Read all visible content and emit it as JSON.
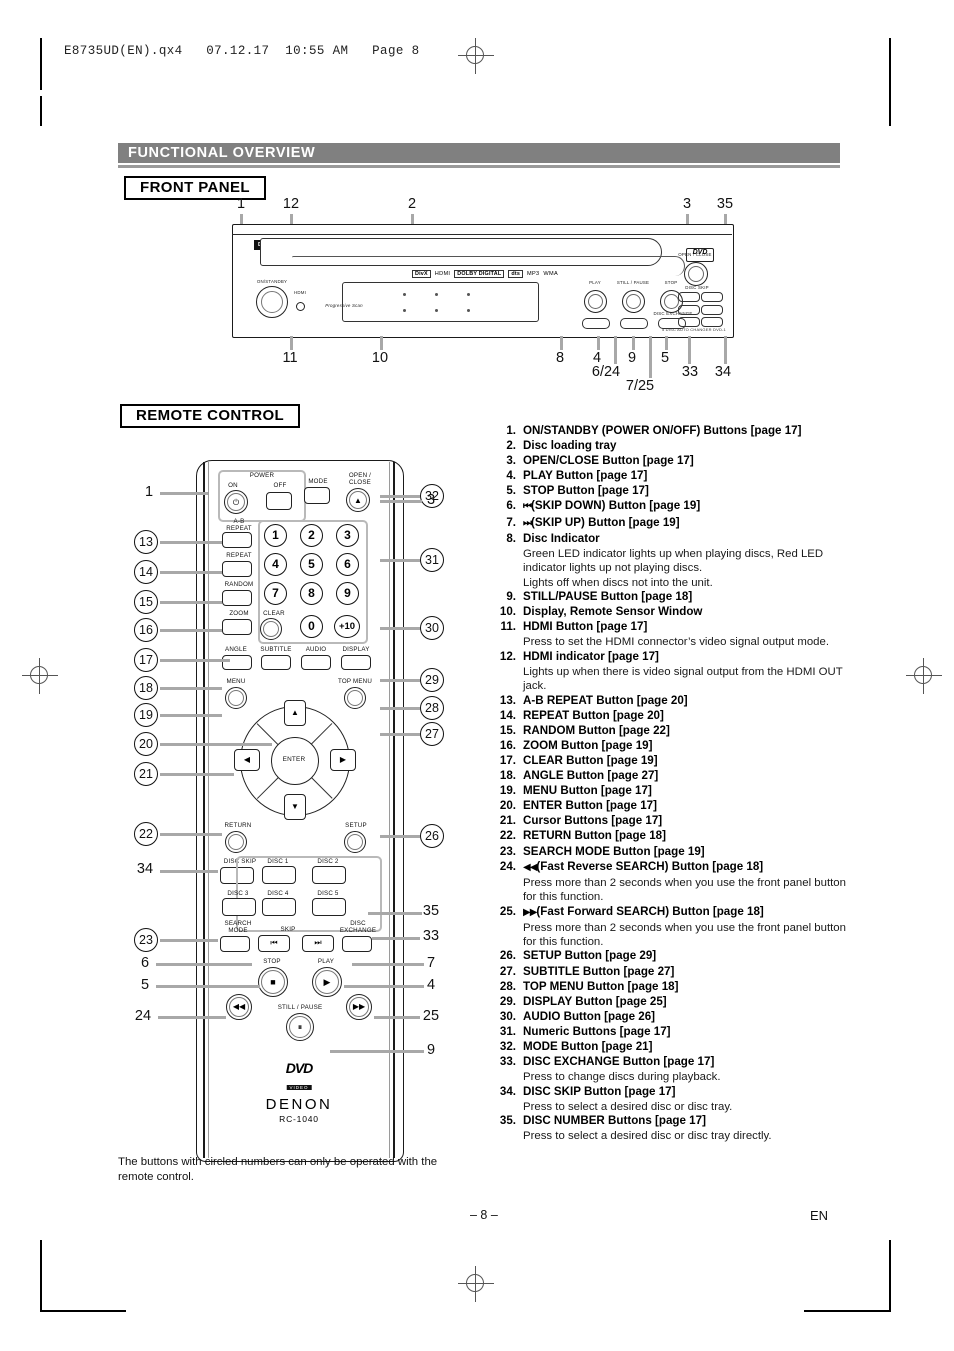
{
  "file_header": "E8735UD(EN).qx4   07.12.17  10:55 AM   Page 8",
  "section": {
    "banner_title": "FUNCTIONAL OVERVIEW"
  },
  "front_panel": {
    "heading": "FRONT PANEL",
    "brand": "DENON",
    "dvd_logo": "DVD",
    "dvd_logo_sub": "VIDEO",
    "model_text": "5 DISC AUTO CHANGER  DVD-1",
    "badges": [
      "DivX",
      "HDMI",
      "DOLBY DIGITAL",
      "dts",
      "MP3",
      "WMA"
    ],
    "progressive_label": "Progressive Scan",
    "power_label": "ON/STANDBY",
    "open_close_label": "OPEN / CLOSE",
    "disc_skip_label": "DISC SKIP",
    "disc_exchange_label": "DISC EXCHANGE",
    "button_labels": [
      "PLAY",
      "STILL / PAUSE",
      "STOP"
    ],
    "callouts_top": [
      "1",
      "12",
      "2",
      "3",
      "35"
    ],
    "callouts_bottom": [
      "11",
      "10",
      "8",
      "4",
      "9",
      "5",
      "6/24",
      "7/25",
      "33",
      "34"
    ]
  },
  "remote": {
    "heading": "REMOTE CONTROL",
    "labels": {
      "power": "POWER",
      "power_on": "ON",
      "power_off": "OFF",
      "mode": "MODE",
      "open_close": "OPEN /\nCLOSE",
      "ab_repeat": "A-B\nREPEAT",
      "repeat": "REPEAT",
      "random": "RANDOM",
      "zoom": "ZOOM",
      "clear": "CLEAR",
      "angle": "ANGLE",
      "subtitle": "SUBTITLE",
      "audio": "AUDIO",
      "display": "DISPLAY",
      "menu": "MENU",
      "top_menu": "TOP MENU",
      "enter": "ENTER",
      "return": "RETURN",
      "setup": "SETUP",
      "disc_skip": "DISC SKIP",
      "search_mode": "SEARCH\nMODE",
      "disc_exchange": "DISC\nEXCHANGE",
      "skip": "SKIP",
      "stop": "STOP",
      "play": "PLAY",
      "still_pause": "STILL / PAUSE"
    },
    "numeric_keys": [
      "1",
      "2",
      "3",
      "4",
      "5",
      "6",
      "7",
      "8",
      "9",
      "0",
      "+10"
    ],
    "disc_keys": [
      "DISC 1",
      "DISC 2",
      "DISC 3",
      "DISC 4",
      "DISC 5"
    ],
    "dvd_logo": "DVD",
    "dvd_logo_sub": "VIDEO",
    "brand": "DENON",
    "model": "RC-1040",
    "callouts_left": [
      "1",
      "13",
      "14",
      "15",
      "16",
      "17",
      "18",
      "19",
      "20",
      "21",
      "22",
      "34",
      "23",
      "6",
      "5",
      "24"
    ],
    "callouts_right": [
      "32",
      "3",
      "31",
      "30",
      "29",
      "28",
      "27",
      "26",
      "35",
      "33",
      "7",
      "4",
      "25",
      "9"
    ]
  },
  "items": [
    {
      "n": "1.",
      "title": "ON/STANDBY (POWER ON/OFF) Buttons [page 17]"
    },
    {
      "n": "2.",
      "title": "Disc loading tray"
    },
    {
      "n": "3.",
      "title": "OPEN/CLOSE Button [page 17]"
    },
    {
      "n": "4.",
      "title": "PLAY Button [page 17]"
    },
    {
      "n": "5.",
      "title": "STOP Button [page 17]"
    },
    {
      "n": "6.",
      "title": "(SKIP DOWN) Button [page 19]",
      "sym": "⏮"
    },
    {
      "n": "7.",
      "title": "(SKIP UP) Button [page 19]",
      "sym": "⏭"
    },
    {
      "n": "8.",
      "title": "Disc Indicator",
      "desc": "Green LED indicator lights up when playing discs, Red LED indicator lights up not playing discs.\nLights off when discs not into the unit."
    },
    {
      "n": "9.",
      "title": "STILL/PAUSE Button [page 18]"
    },
    {
      "n": "10.",
      "title": "Display, Remote Sensor Window"
    },
    {
      "n": "11.",
      "title": "HDMI Button [page 17]",
      "desc": "Press to set the HDMI connector’s video signal output mode."
    },
    {
      "n": "12.",
      "title": "HDMI indicator [page 17]",
      "desc": "Lights up when there is video signal output from the HDMI OUT jack."
    },
    {
      "n": "13.",
      "title": "A-B REPEAT Button [page 20]"
    },
    {
      "n": "14.",
      "title": "REPEAT Button [page 20]"
    },
    {
      "n": "15.",
      "title": "RANDOM Button [page 22]"
    },
    {
      "n": "16.",
      "title": "ZOOM Button [page 19]"
    },
    {
      "n": "17.",
      "title": "CLEAR Button [page 19]"
    },
    {
      "n": "18.",
      "title": "ANGLE Button [page 27]"
    },
    {
      "n": "19.",
      "title": "MENU Button [page 17]"
    },
    {
      "n": "20.",
      "title": "ENTER Button [page 17]"
    },
    {
      "n": "21.",
      "title": "Cursor Buttons [page 17]"
    },
    {
      "n": "22.",
      "title": "RETURN Button [page 18]"
    },
    {
      "n": "23.",
      "title": "SEARCH MODE Button [page 19]"
    },
    {
      "n": "24.",
      "title": "(Fast Reverse SEARCH) Button [page 18]",
      "sym": "◀◀",
      "desc": "Press more than 2 seconds when you use the front panel button for this function."
    },
    {
      "n": "25.",
      "title": "(Fast Forward SEARCH) Button [page 18]",
      "sym": "▶▶",
      "desc": "Press more than 2 seconds when you use the front panel button for this function."
    },
    {
      "n": "26.",
      "title": "SETUP Button [page 29]"
    },
    {
      "n": "27.",
      "title": "SUBTITLE Button [page 27]"
    },
    {
      "n": "28.",
      "title": "TOP MENU Button [page 18]"
    },
    {
      "n": "29.",
      "title": "DISPLAY Button [page 25]"
    },
    {
      "n": "30.",
      "title": "AUDIO Button [page 26]"
    },
    {
      "n": "31.",
      "title": "Numeric Buttons [page 17]"
    },
    {
      "n": "32.",
      "title": "MODE Button [page 21]"
    },
    {
      "n": "33.",
      "title": "DISC EXCHANGE Button [page 17]",
      "desc": "Press to change discs during playback."
    },
    {
      "n": "34.",
      "title": "DISC SKIP Button [page 17]",
      "desc": "Press to select a desired disc or disc tray."
    },
    {
      "n": "35.",
      "title": "DISC NUMBER Buttons [page 17]",
      "desc": "Press to select a desired disc or disc tray directly."
    }
  ],
  "footnote": "The buttons with circled numbers can only be operated with the remote control.",
  "footer": {
    "page": "– 8 –",
    "lang": "EN"
  }
}
